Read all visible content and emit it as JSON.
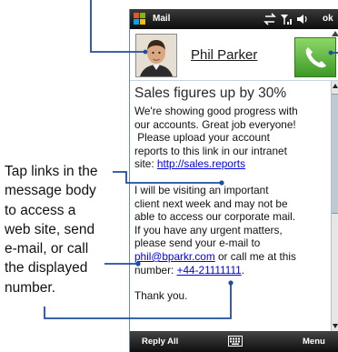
{
  "callout": {
    "lines": [
      "Tap links in the",
      "message body",
      "to access a",
      "web site, send",
      "e-mail, or call",
      "the displayed",
      "number."
    ]
  },
  "statusbar": {
    "title": "Mail",
    "ok": "ok"
  },
  "header": {
    "sender": "Phil Parker"
  },
  "message": {
    "subject": "Sales figures up by 30%",
    "p1": [
      "We're showing good progress with",
      "our accounts. Great job everyone!",
      " Please upload your account",
      "reports to this link in our intranet"
    ],
    "p1_site_label": "site: ",
    "p1_link": "http://sales.reports",
    "p2": [
      "I will be visiting an important",
      "client next week and may not be",
      "able to access our corporate mail.",
      "If you have any urgent matters,",
      "please send your e-mail to"
    ],
    "p2_email": "phil@bparkr.com",
    "p2_after_email": " or call me at this",
    "p2_number_label": "number: ",
    "p2_phone": "+44-21111111",
    "p2_end": ".",
    "p3": "Thank you."
  },
  "softkeys": {
    "left": "Reply All",
    "right": "Menu"
  },
  "icons": {
    "windows_logo": "windows-flag-icon",
    "status": [
      "connectivity-icon",
      "signal-icon",
      "volume-icon"
    ],
    "call": "phone-handset-icon",
    "keyboard": "keyboard-icon"
  },
  "colors": {
    "link": "#0000ee",
    "callout_line": "#1f4e9e",
    "call_green": "#3d9a25"
  }
}
